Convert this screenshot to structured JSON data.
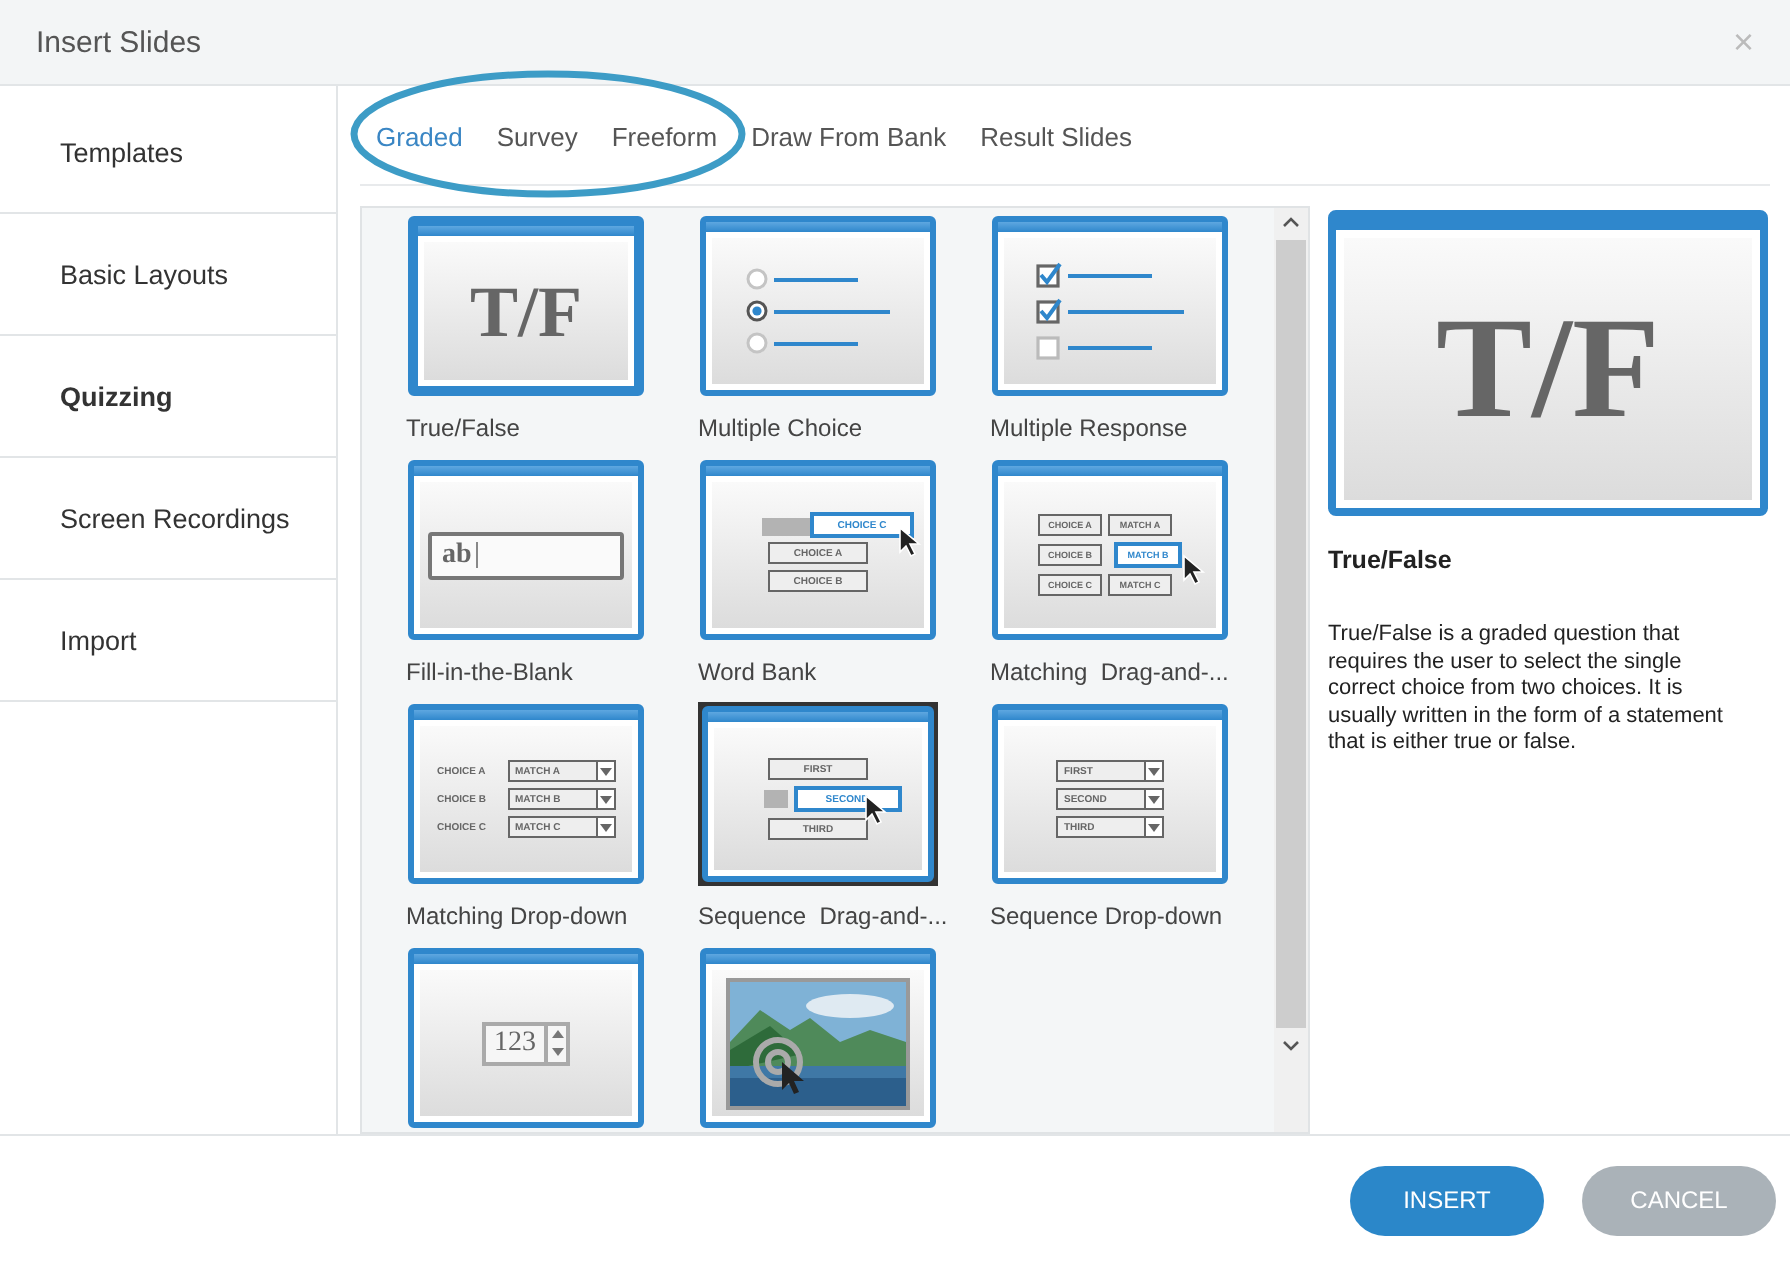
{
  "window": {
    "title": "Insert Slides",
    "close": "×"
  },
  "sidebar": {
    "items": [
      {
        "label": "Templates",
        "selected": false
      },
      {
        "label": "Basic Layouts",
        "selected": false
      },
      {
        "label": "Quizzing",
        "selected": true
      },
      {
        "label": "Screen Recordings",
        "selected": false
      },
      {
        "label": "Import",
        "selected": false
      }
    ]
  },
  "tabs": [
    {
      "label": "Graded",
      "selected": true
    },
    {
      "label": "Survey",
      "selected": false
    },
    {
      "label": "Freeform",
      "selected": false
    },
    {
      "label": "Draw From Bank",
      "selected": false
    },
    {
      "label": "Result Slides",
      "selected": false
    }
  ],
  "slides": [
    {
      "label": "True/False",
      "kind": "tf",
      "selected": true,
      "hovered": false,
      "items": [
        "T/F"
      ]
    },
    {
      "label": "Multiple Choice",
      "kind": "radio",
      "selected": false,
      "hovered": false,
      "options": [
        {
          "selected": false
        },
        {
          "selected": true
        },
        {
          "selected": false
        }
      ]
    },
    {
      "label": "Multiple Response",
      "kind": "check",
      "selected": false,
      "hovered": false,
      "options": [
        {
          "checked": true
        },
        {
          "checked": true
        },
        {
          "checked": false
        }
      ]
    },
    {
      "label": "Fill-in-the-Blank",
      "kind": "fill",
      "selected": false,
      "hovered": false,
      "items": [
        "ab"
      ]
    },
    {
      "label": "Word Bank",
      "kind": "wordbank",
      "selected": false,
      "hovered": false,
      "items": [
        "CHOICE C",
        "CHOICE A",
        "CHOICE B"
      ]
    },
    {
      "label": "Matching  Drag-and-...",
      "kind": "matchdrag",
      "selected": false,
      "hovered": false,
      "items": [
        "CHOICE A",
        "CHOICE B",
        "CHOICE C"
      ],
      "matches": [
        "MATCH A",
        "MATCH B",
        "MATCH C"
      ]
    },
    {
      "label": "Matching Drop-down",
      "kind": "matchdrop",
      "selected": false,
      "hovered": false,
      "items": [
        "CHOICE A",
        "CHOICE B",
        "CHOICE C"
      ],
      "matches": [
        "MATCH A",
        "MATCH B",
        "MATCH C"
      ]
    },
    {
      "label": "Sequence  Drag-and-...",
      "kind": "seqdrag",
      "selected": false,
      "hovered": true,
      "items": [
        "FIRST",
        "SECOND",
        "THIRD"
      ]
    },
    {
      "label": "Sequence Drop-down",
      "kind": "seqdrop",
      "selected": false,
      "hovered": false,
      "items": [
        "FIRST",
        "SECOND",
        "THIRD"
      ]
    },
    {
      "kind": "numeric",
      "selected": false,
      "hovered": false,
      "items": [
        "123"
      ]
    },
    {
      "kind": "hotspot",
      "selected": false,
      "hovered": false
    }
  ],
  "preview": {
    "image_text": "T/F",
    "title": "True/False",
    "description": "True/False is a graded question that requires the user to select the single correct choice from two choices.  It is usually written in the form of a statement that is either true or false."
  },
  "buttons": [
    {
      "label": "INSERT",
      "kind": "primary"
    },
    {
      "label": "CANCEL",
      "kind": "secondary"
    }
  ]
}
